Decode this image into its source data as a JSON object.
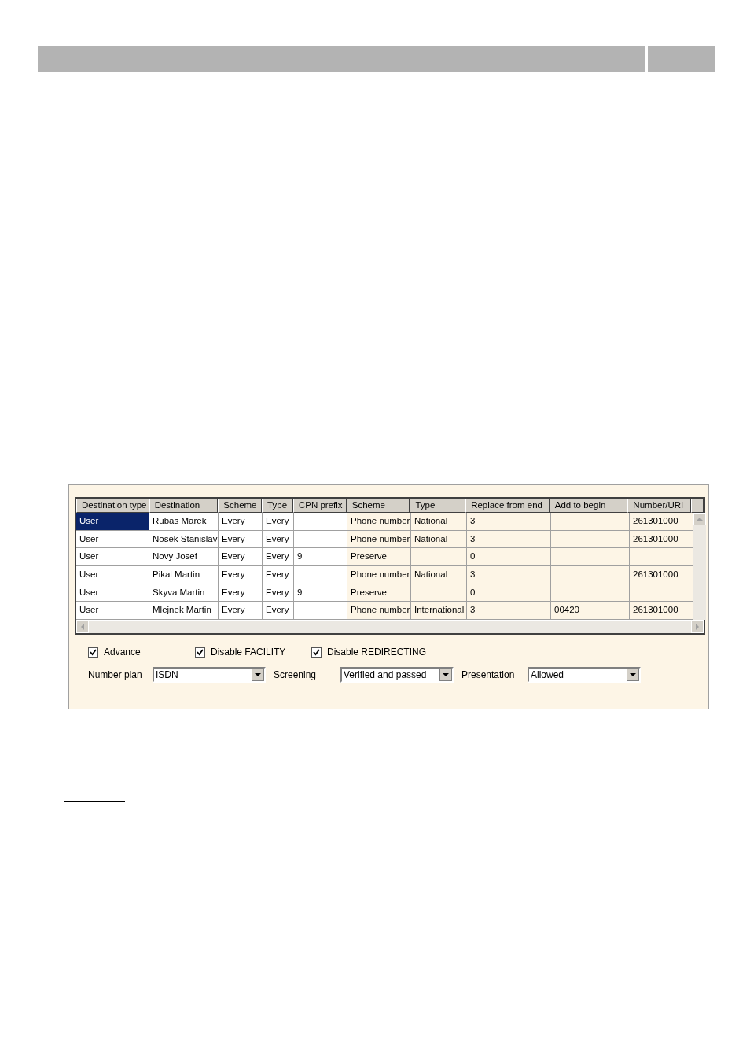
{
  "table": {
    "columns": [
      "Destination type",
      "Destination",
      "Scheme",
      "Type",
      "CPN prefix",
      "Scheme",
      "Type",
      "Replace from end",
      "Add to begin",
      "Number/URI"
    ],
    "rows": [
      {
        "selected": true,
        "cells": [
          "User",
          "Rubas Marek",
          "Every",
          "Every",
          "",
          "Phone number",
          "National",
          "3",
          "",
          "261301000"
        ]
      },
      {
        "selected": false,
        "cells": [
          "User",
          "Nosek Stanislav",
          "Every",
          "Every",
          "",
          "Phone number",
          "National",
          "3",
          "",
          "261301000"
        ]
      },
      {
        "selected": false,
        "cells": [
          "User",
          "Novy Josef",
          "Every",
          "Every",
          "9",
          "Preserve",
          "",
          "0",
          "",
          ""
        ]
      },
      {
        "selected": false,
        "cells": [
          "User",
          "Pikal Martin",
          "Every",
          "Every",
          "",
          "Phone number",
          "National",
          "3",
          "",
          "261301000"
        ]
      },
      {
        "selected": false,
        "cells": [
          "User",
          "Skyva Martin",
          "Every",
          "Every",
          "9",
          "Preserve",
          "",
          "0",
          "",
          ""
        ]
      },
      {
        "selected": false,
        "cells": [
          "User",
          "Mlejnek Martin",
          "Every",
          "Every",
          "",
          "Phone number",
          "International",
          "3",
          "00420",
          "261301000"
        ]
      }
    ]
  },
  "checkboxes": [
    {
      "label": "Advance",
      "checked": true
    },
    {
      "label": "Disable FACILITY",
      "checked": true
    },
    {
      "label": "Disable REDIRECTING",
      "checked": true
    }
  ],
  "dropdowns": [
    {
      "label": "Number plan",
      "value": "ISDN"
    },
    {
      "label": "Screening",
      "value": "Verified and passed"
    },
    {
      "label": "Presentation",
      "value": "Allowed"
    }
  ]
}
